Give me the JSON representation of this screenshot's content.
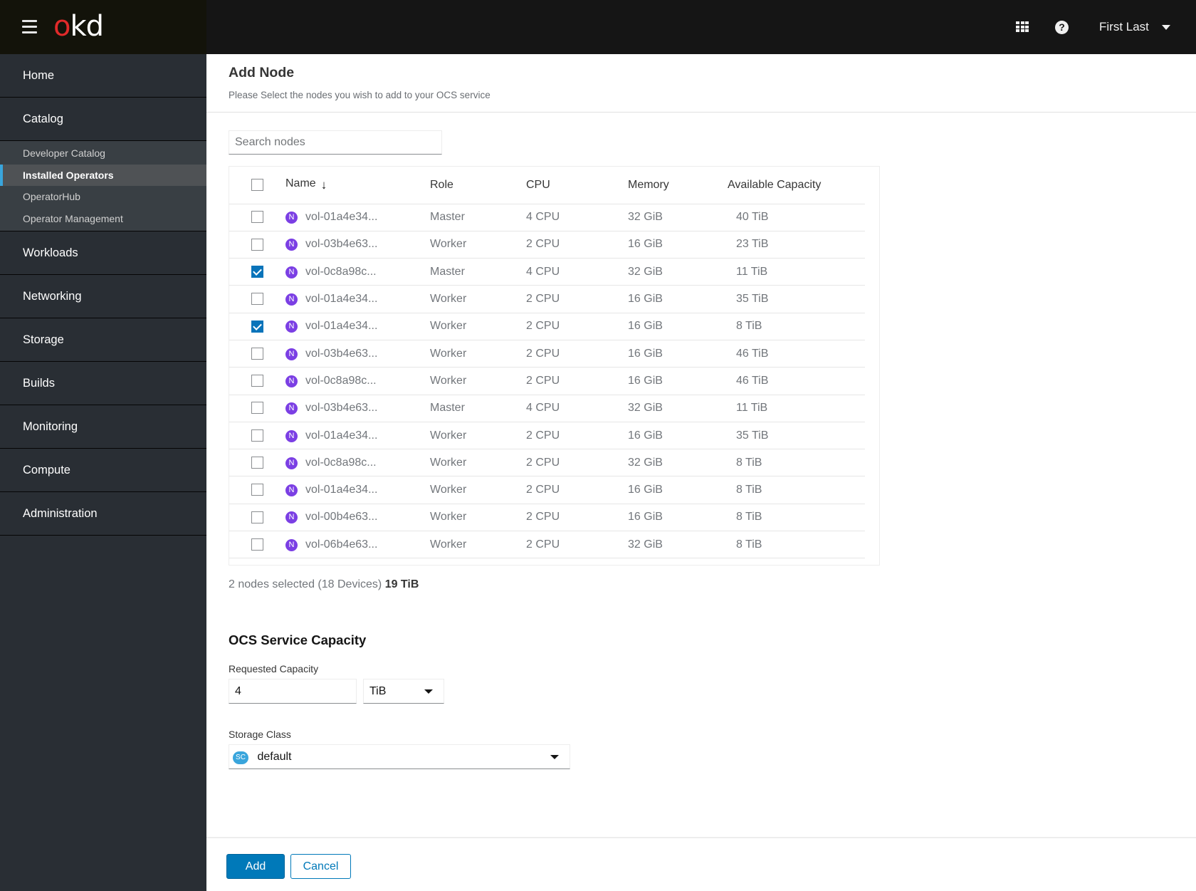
{
  "masthead": {
    "logo_o": "o",
    "logo_kd": "kd",
    "help_glyph": "?",
    "user_name": "First Last",
    "icons": [
      "hamburger-menu-icon",
      "app-launcher-grid-icon",
      "help-question-icon",
      "caret-down-icon"
    ]
  },
  "sidebar": {
    "items": [
      {
        "label": "Home"
      },
      {
        "label": "Catalog",
        "children": [
          {
            "label": "Developer Catalog"
          },
          {
            "label": "Installed Operators",
            "active": true
          },
          {
            "label": "OperatorHub"
          },
          {
            "label": "Operator Management"
          }
        ]
      },
      {
        "label": "Workloads"
      },
      {
        "label": "Networking"
      },
      {
        "label": "Storage"
      },
      {
        "label": "Builds"
      },
      {
        "label": "Monitoring"
      },
      {
        "label": "Compute"
      },
      {
        "label": "Administration"
      }
    ]
  },
  "page": {
    "title": "Add Node",
    "subtitle": "Please Select the nodes you wish to add to your OCS service"
  },
  "search": {
    "placeholder": "Search nodes",
    "value": ""
  },
  "table": {
    "columns": [
      "Name",
      "Role",
      "CPU",
      "Memory",
      "Available Capacity"
    ],
    "sort_icon": "arrow-down-icon",
    "node_badge": "N",
    "rows": [
      {
        "checked": false,
        "name": "vol-01a4e34...",
        "role": "Master",
        "cpu": "4 CPU",
        "memory": "32 GiB",
        "capacity": "40 TiB"
      },
      {
        "checked": false,
        "name": "vol-03b4e63...",
        "role": "Worker",
        "cpu": "2 CPU",
        "memory": "16 GiB",
        "capacity": "23 TiB"
      },
      {
        "checked": true,
        "name": "vol-0c8a98c...",
        "role": "Master",
        "cpu": "4 CPU",
        "memory": "32 GiB",
        "capacity": "11 TiB"
      },
      {
        "checked": false,
        "name": "vol-01a4e34...",
        "role": "Worker",
        "cpu": "2 CPU",
        "memory": "16 GiB",
        "capacity": "35 TiB"
      },
      {
        "checked": true,
        "name": "vol-01a4e34...",
        "role": "Worker",
        "cpu": "2 CPU",
        "memory": "16 GiB",
        "capacity": "8 TiB"
      },
      {
        "checked": false,
        "name": "vol-03b4e63...",
        "role": "Worker",
        "cpu": "2 CPU",
        "memory": "16 GiB",
        "capacity": "46 TiB"
      },
      {
        "checked": false,
        "name": "vol-0c8a98c...",
        "role": "Worker",
        "cpu": "2 CPU",
        "memory": "16 GiB",
        "capacity": "46 TiB"
      },
      {
        "checked": false,
        "name": "vol-03b4e63...",
        "role": "Master",
        "cpu": "4 CPU",
        "memory": "32 GiB",
        "capacity": "11 TiB"
      },
      {
        "checked": false,
        "name": "vol-01a4e34...",
        "role": "Worker",
        "cpu": "2 CPU",
        "memory": "16 GiB",
        "capacity": "35 TiB"
      },
      {
        "checked": false,
        "name": "vol-0c8a98c...",
        "role": "Worker",
        "cpu": "2 CPU",
        "memory": "32 GiB",
        "capacity": "8 TiB"
      },
      {
        "checked": false,
        "name": "vol-01a4e34...",
        "role": "Worker",
        "cpu": "2 CPU",
        "memory": "16 GiB",
        "capacity": "8 TiB"
      },
      {
        "checked": false,
        "name": "vol-00b4e63...",
        "role": "Worker",
        "cpu": "2 CPU",
        "memory": "16 GiB",
        "capacity": "8 TiB"
      },
      {
        "checked": false,
        "name": "vol-06b4e63...",
        "role": "Worker",
        "cpu": "2 CPU",
        "memory": "32 GiB",
        "capacity": "8 TiB"
      }
    ]
  },
  "summary": {
    "text": "2 nodes selected (18 Devices)",
    "total": "19 TiB"
  },
  "ocs": {
    "section_title": "OCS Service Capacity",
    "requested_label": "Requested Capacity",
    "requested_value": "4",
    "unit_value": "TiB",
    "storage_class_label": "Storage Class",
    "storage_class_badge": "SC",
    "storage_class_value": "default"
  },
  "footer": {
    "add_label": "Add",
    "cancel_label": "Cancel"
  },
  "colors": {
    "masthead": "#151515",
    "sidebar": "#292e34",
    "subnav": "#393f44",
    "active_indicator": "#39a5dc",
    "logo_red": "#e12a2a",
    "primary": "#0079b9",
    "node_badge": "#7b3fe4",
    "sc_badge": "#39a5dc"
  }
}
